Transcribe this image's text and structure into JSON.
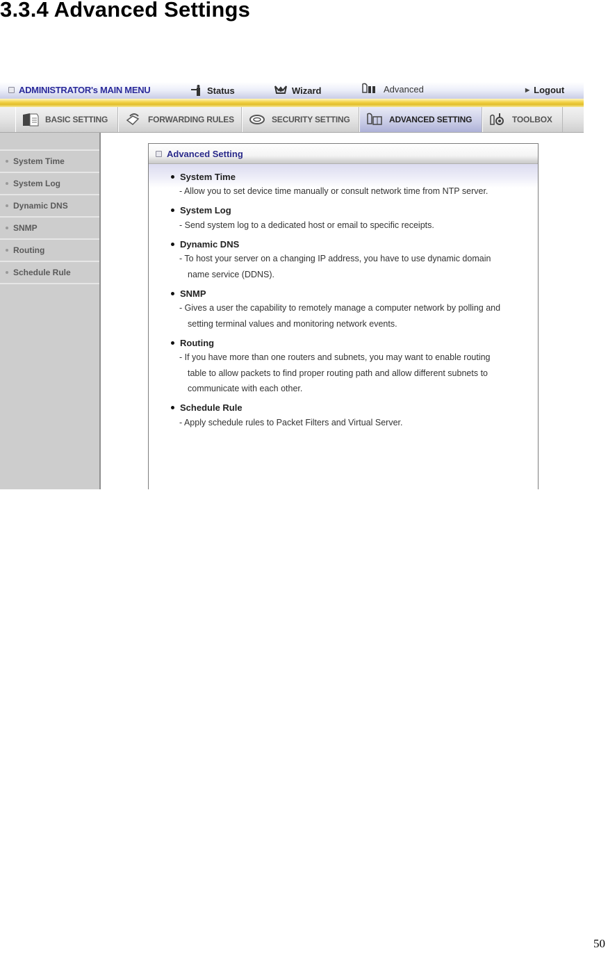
{
  "document": {
    "section_title": "3.3.4 Advanced Settings",
    "page_number": "50"
  },
  "topbar": {
    "admin_menu": "ADMINISTRATOR's MAIN MENU",
    "status": "Status",
    "wizard": "Wizard",
    "advanced": "Advanced",
    "logout": "Logout"
  },
  "tabs": [
    {
      "label": "BASIC SETTING",
      "icon": "folder-icon"
    },
    {
      "label": "FORWARDING RULES",
      "icon": "forwarding-icon"
    },
    {
      "label": "SECURITY SETTING",
      "icon": "security-icon"
    },
    {
      "label": "ADVANCED SETTING",
      "icon": "advanced-icon",
      "active": true
    },
    {
      "label": "TOOLBOX",
      "icon": "toolbox-icon"
    }
  ],
  "sidebar": {
    "items": [
      {
        "label": "System Time"
      },
      {
        "label": "System Log"
      },
      {
        "label": "Dynamic DNS"
      },
      {
        "label": "SNMP"
      },
      {
        "label": "Routing"
      },
      {
        "label": "Schedule Rule"
      }
    ]
  },
  "panel": {
    "title": "Advanced Setting",
    "features": [
      {
        "title": "System Time",
        "desc": "Allow you to set device time manually or consult network time from NTP server."
      },
      {
        "title": "System Log",
        "desc": "Send system log to a dedicated host or email to specific receipts."
      },
      {
        "title": "Dynamic DNS",
        "desc": "To host your server on a changing IP address, you have to use dynamic domain name service (DDNS)."
      },
      {
        "title": "SNMP",
        "desc": "Gives a user the capability to remotely manage a computer network by polling and setting terminal values and monitoring network events."
      },
      {
        "title": "Routing",
        "desc": "If you have more than one routers and subnets, you may want to enable routing table to allow packets to find proper routing path and allow different subnets to communicate with each other."
      },
      {
        "title": "Schedule Rule",
        "desc": "Apply schedule rules to Packet Filters and Virtual Server."
      }
    ]
  },
  "colors": {
    "admin_text": "#2a2a9a",
    "accent_band": "#f2d34a",
    "active_tab": "#c8cbe6",
    "sidebar_bg": "#cdcdcd"
  }
}
